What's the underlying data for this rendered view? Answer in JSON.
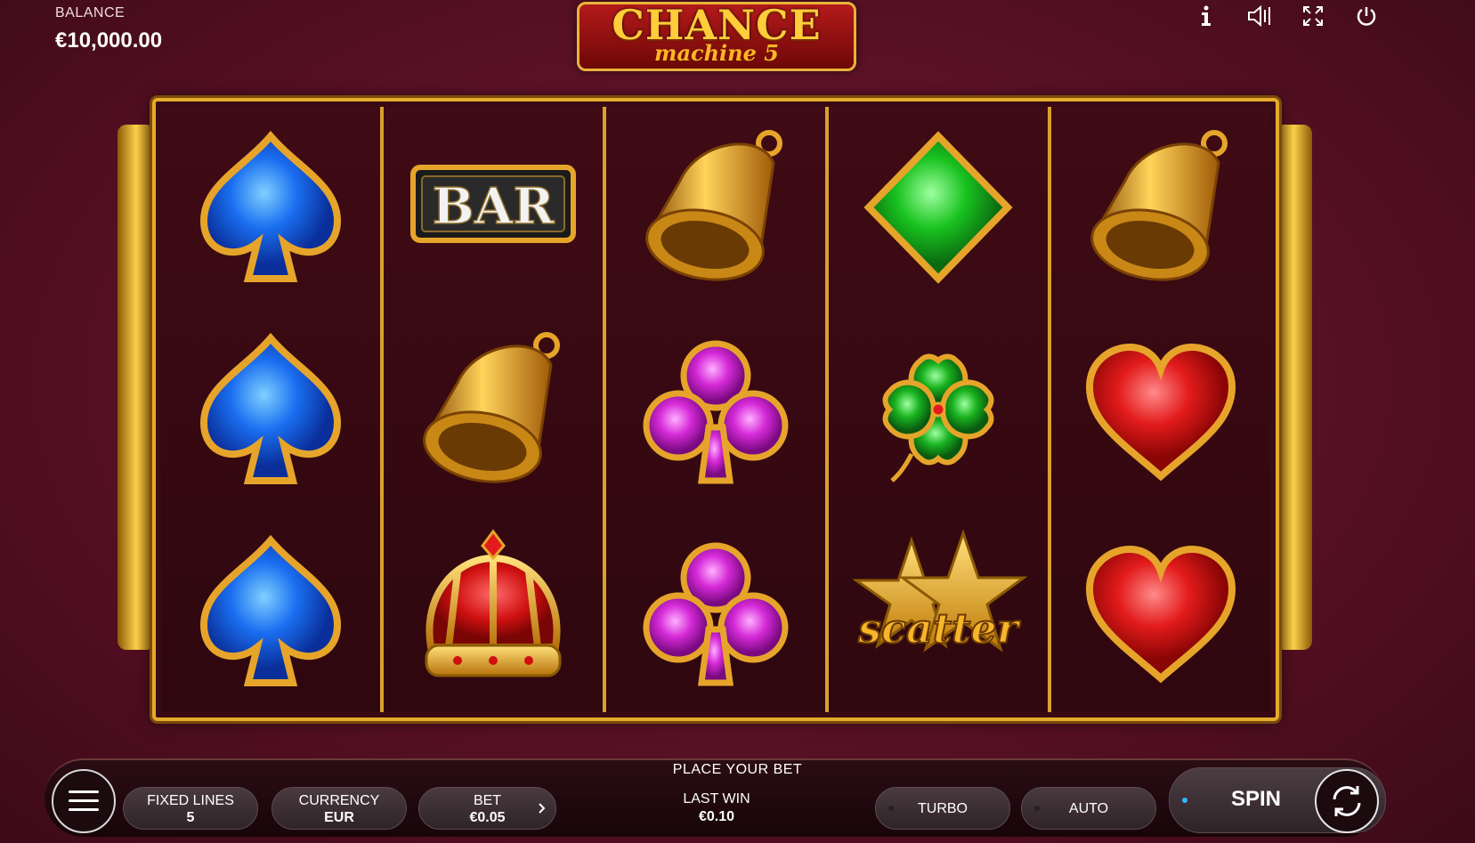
{
  "header": {
    "balance_label": "BALANCE",
    "balance_value": "€10,000.00",
    "logo_line1": "CHANCE",
    "logo_line2": "machine 5",
    "icons": [
      "info-icon",
      "sound-icon",
      "fullscreen-icon",
      "power-icon"
    ]
  },
  "reels": [
    [
      "spade",
      "spade",
      "spade"
    ],
    [
      "bar",
      "bell",
      "crown"
    ],
    [
      "bell",
      "club",
      "club"
    ],
    [
      "diamond",
      "clover",
      "scatter"
    ],
    [
      "bell",
      "heart",
      "heart"
    ]
  ],
  "symbols": {
    "bar_text": "BAR",
    "scatter_text": "scatter"
  },
  "controls": {
    "place_bet": "PLACE YOUR BET",
    "fixed_lines_label": "FIXED LINES",
    "fixed_lines_value": "5",
    "currency_label": "CURRENCY",
    "currency_value": "EUR",
    "bet_label": "BET",
    "bet_value": "€0.05",
    "last_win_label": "LAST WIN",
    "last_win_value": "€0.10",
    "turbo_label": "TURBO",
    "auto_label": "AUTO",
    "spin_label": "SPIN"
  },
  "colors": {
    "gold": "#e6aa2c",
    "background": "#5e1227",
    "spin_indicator": "#2fb6ff"
  }
}
